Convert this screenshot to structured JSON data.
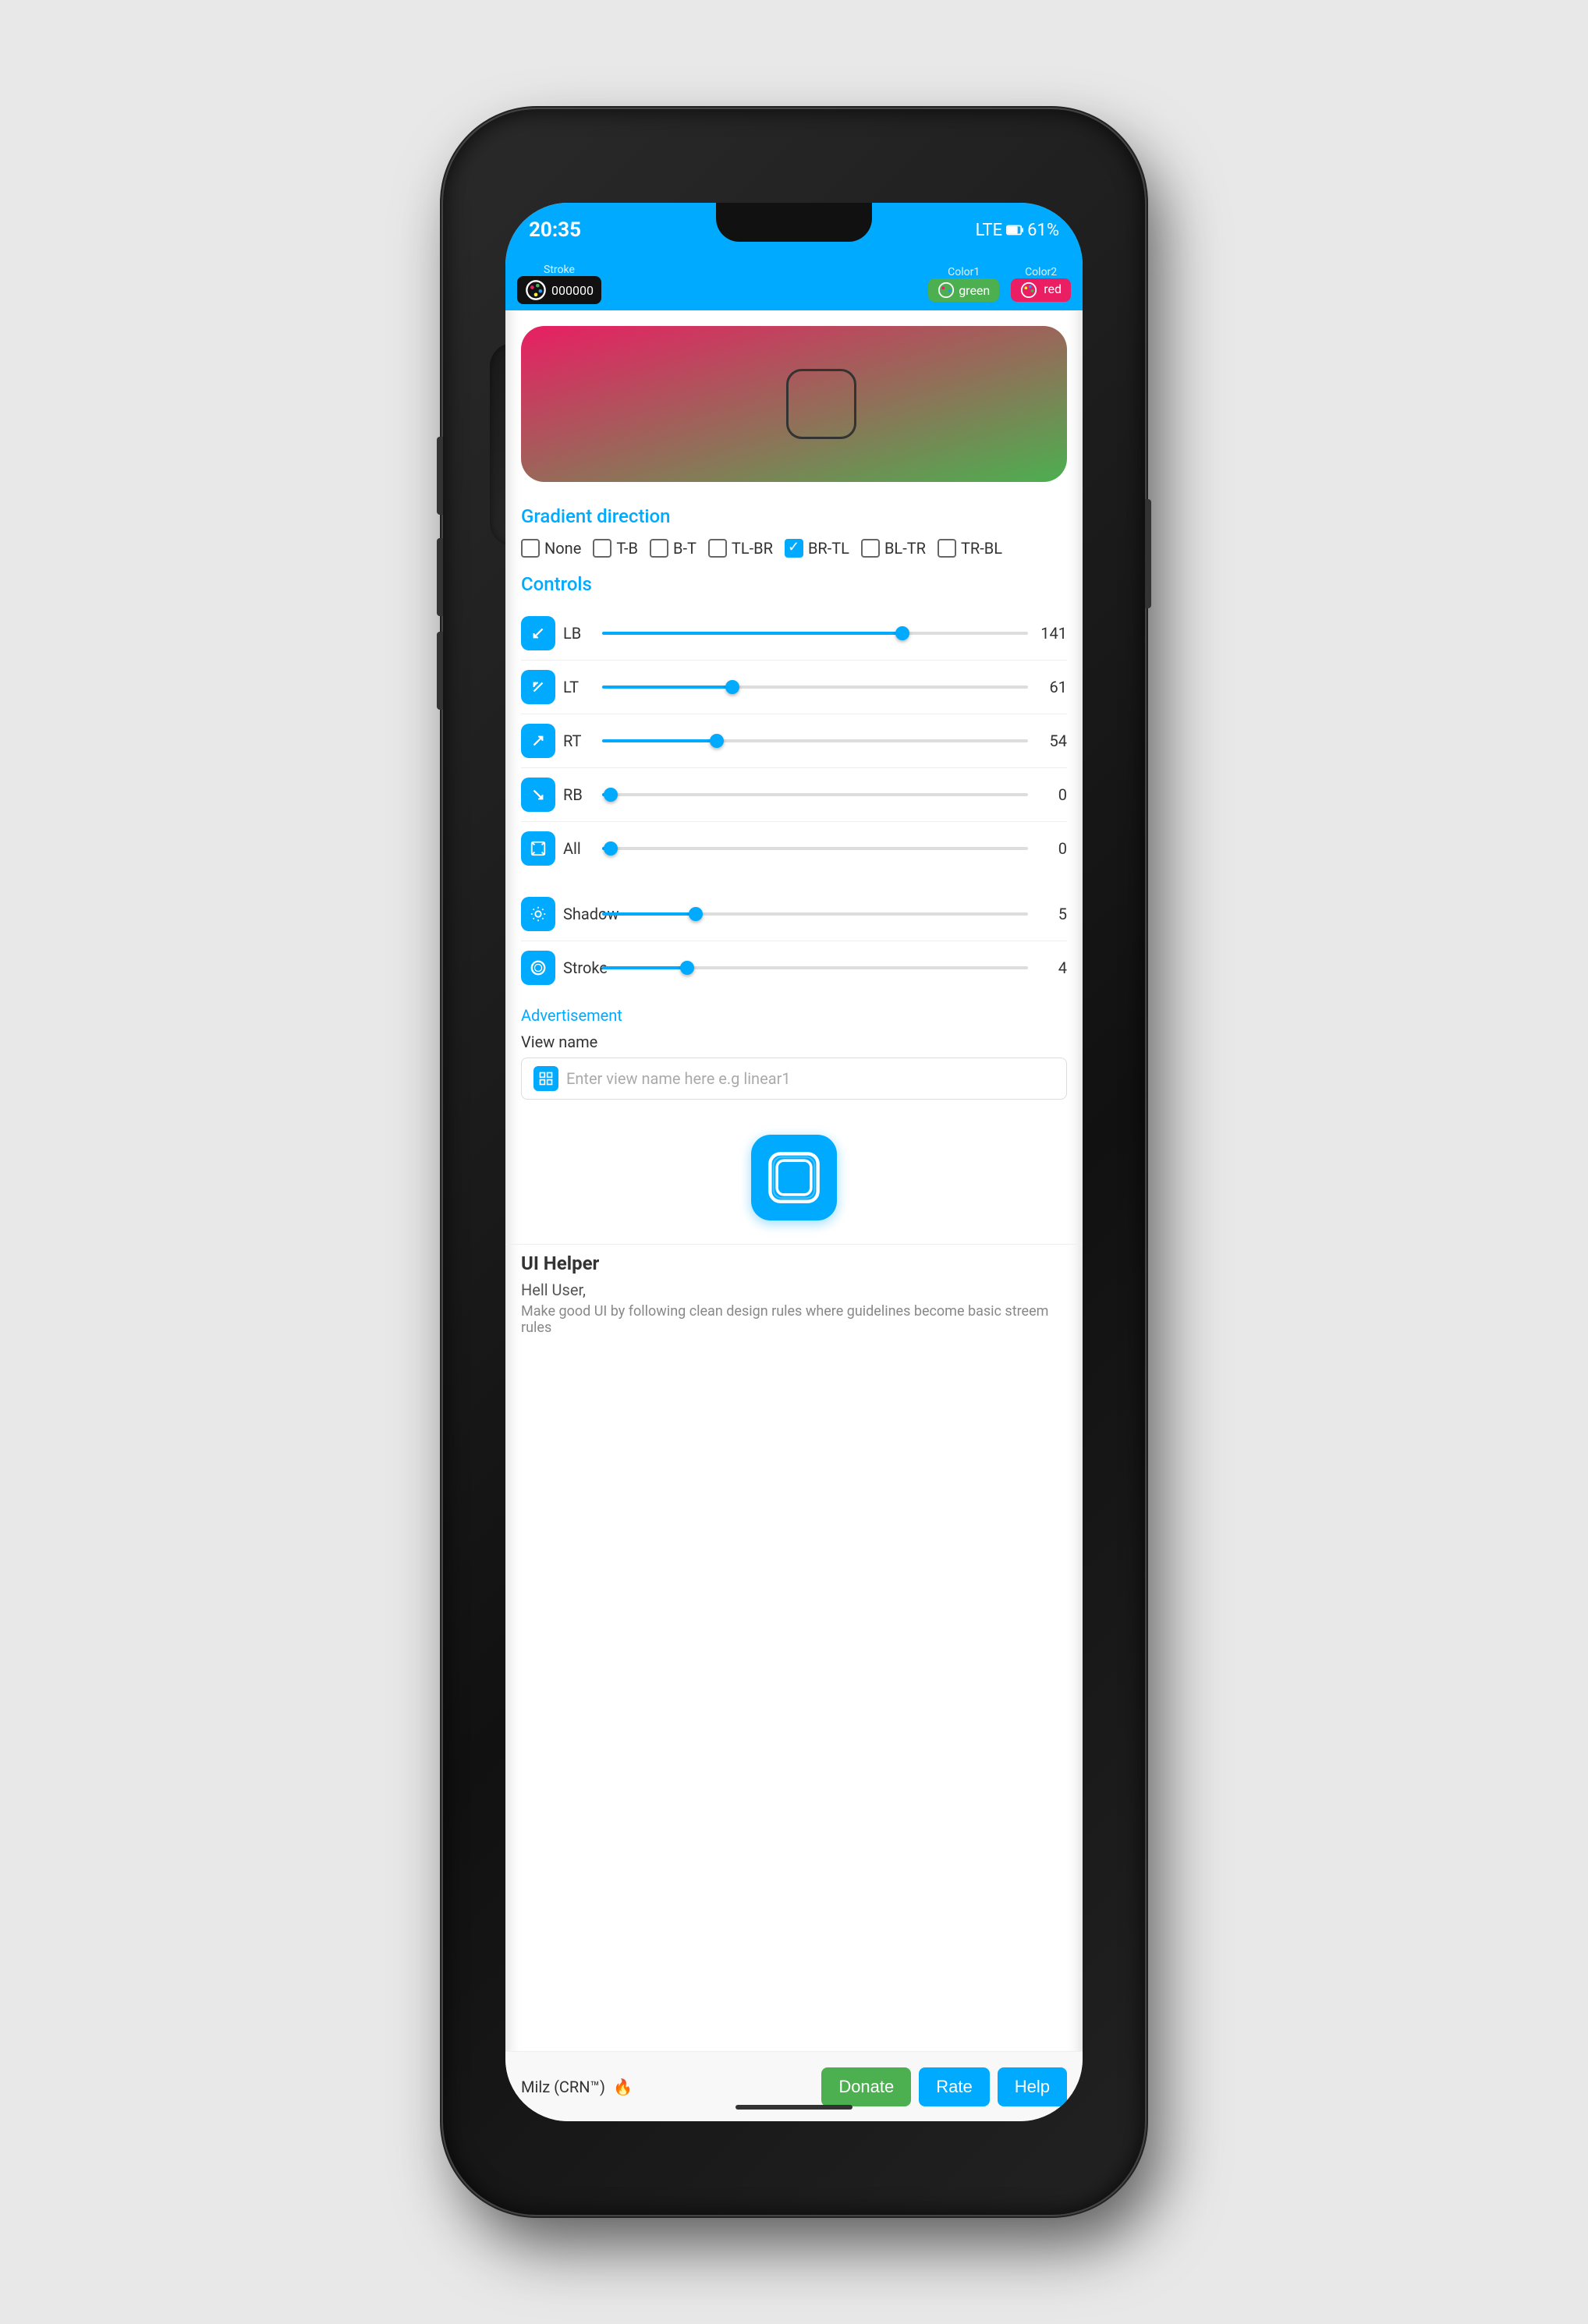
{
  "phone": {
    "status_bar": {
      "time": "20:35",
      "battery_percent": "61%",
      "signal": "LTE",
      "icons": [
        "notification-icon",
        "play-icon",
        "download-icon"
      ]
    },
    "toolbar": {
      "stroke_label": "Stroke",
      "color_hex": "000000",
      "color1_label": "Color1",
      "color1_value": "green",
      "color2_label": "Color2",
      "color2_value": "red"
    },
    "gradient_preview": {
      "from_color": "#e91e63",
      "to_color": "#4caf50"
    },
    "gradient_direction": {
      "label": "Gradient direction",
      "options": [
        {
          "id": "none",
          "label": "None",
          "checked": false
        },
        {
          "id": "tb",
          "label": "T-B",
          "checked": false
        },
        {
          "id": "bt",
          "label": "B-T",
          "checked": false
        },
        {
          "id": "tlbr",
          "label": "TL-BR",
          "checked": false
        },
        {
          "id": "brtl",
          "label": "BR-TL",
          "checked": true
        },
        {
          "id": "bltr",
          "label": "BL-TR",
          "checked": false
        },
        {
          "id": "trbl",
          "label": "TR-BL",
          "checked": false
        }
      ]
    },
    "controls": {
      "section_label": "Controls",
      "items": [
        {
          "id": "lb",
          "label": "LB",
          "value": 141,
          "max": 200,
          "icon": "arrow-lb"
        },
        {
          "id": "lt",
          "label": "LT",
          "value": 61,
          "max": 200,
          "icon": "arrow-lt"
        },
        {
          "id": "rt",
          "label": "RT",
          "value": 54,
          "max": 200,
          "icon": "arrow-rt"
        },
        {
          "id": "rb",
          "label": "RB",
          "value": 0,
          "max": 200,
          "icon": "arrow-rb"
        },
        {
          "id": "all",
          "label": "All",
          "value": 0,
          "max": 200,
          "icon": "expand-all"
        }
      ],
      "shadow": {
        "label": "Shadow",
        "value": 5,
        "max": 50,
        "icon": "settings"
      },
      "stroke": {
        "label": "Stroke",
        "value": 4,
        "max": 50,
        "icon": "stroke-circle"
      }
    },
    "advertisement_label": "Advertisement",
    "view_name": {
      "label": "View name",
      "placeholder": "Enter view name here e.g linear1"
    },
    "ui_helper": {
      "title": "UI Helper",
      "greeting": "Hell User,",
      "subtext": "Make good UI by following clean design rules where guidelines become basic streem rules"
    },
    "author": "Milz (CRN™)",
    "fire_emoji": "🔥",
    "bottom_buttons": {
      "donate": "Donate",
      "rate": "Rate",
      "help": "Help"
    }
  }
}
